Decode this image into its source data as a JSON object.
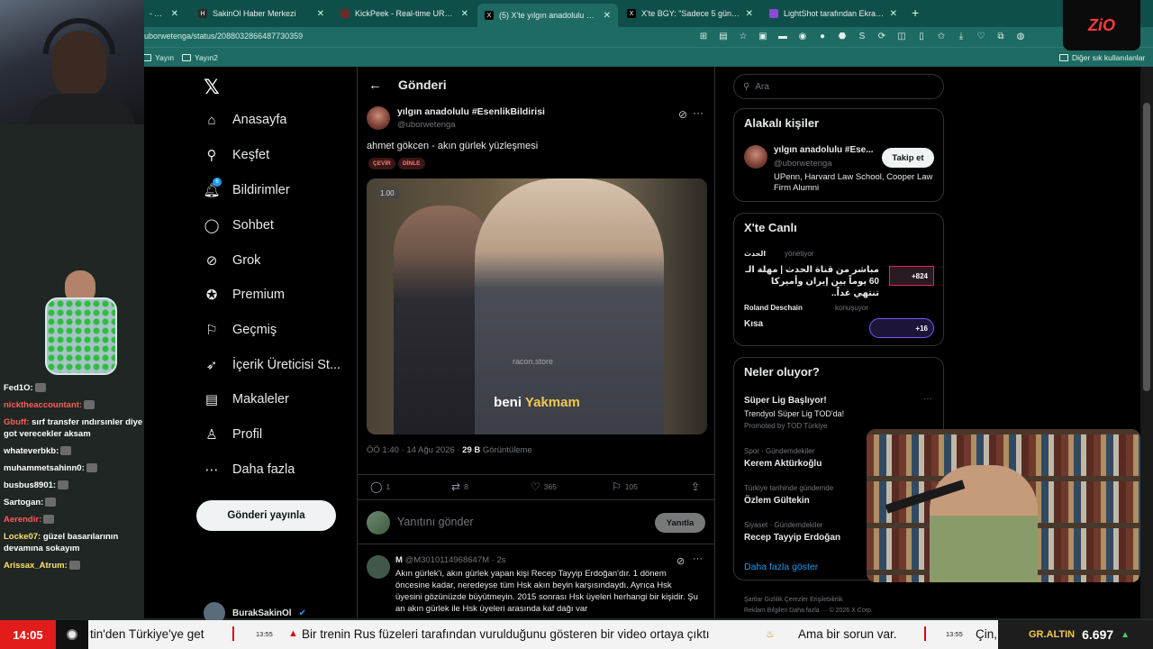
{
  "browser": {
    "tabs": [
      {
        "label": "- Arama -"
      },
      {
        "label": "SakinOl Haber Merkezi"
      },
      {
        "label": "KickPeek - Real-time URL Crawler"
      },
      {
        "label": "(5) X'te yılgın anadolulu #Esen"
      },
      {
        "label": "X'te BGY: \"Sadece 5 gün önce kün"
      },
      {
        "label": "LightShot tarafından Ekran Görün"
      }
    ],
    "url": "uborwetenga/status/2088032866487730359",
    "bookmarks": {
      "items": [
        "Yayın",
        "Yayın2"
      ],
      "other": "Diğer sık kullanılanlar"
    }
  },
  "nav": {
    "items": [
      {
        "label": "Anasayfa",
        "icon": "home-icon"
      },
      {
        "label": "Keşfet",
        "icon": "search-icon"
      },
      {
        "label": "Bildirimler",
        "icon": "bell-icon"
      },
      {
        "label": "Sohbet",
        "icon": "chat-icon"
      },
      {
        "label": "Grok",
        "icon": "grok-icon"
      },
      {
        "label": "Premium",
        "icon": "premium-icon"
      },
      {
        "label": "Geçmiş",
        "icon": "bookmark-icon"
      },
      {
        "label": "İçerik Üreticisi St...",
        "icon": "rocket-icon"
      },
      {
        "label": "Makaleler",
        "icon": "article-icon"
      },
      {
        "label": "Profil",
        "icon": "person-icon"
      },
      {
        "label": "Daha fazla",
        "icon": "more-circle-icon"
      }
    ],
    "notif_count": "6",
    "post_button": "Gönderi yayınla",
    "profile_name": "BurakSakinOl"
  },
  "post": {
    "header": "Gönderi",
    "author_name": "yılgın anadolulu #EsenlikBildirisi",
    "author_handle": "@uborwetenga",
    "text": "ahmet gökcen - akın gürlek yüzleşmesi",
    "pills": [
      "ÇEVİR",
      "DİNLE"
    ],
    "video": {
      "badge": "1.00",
      "watermark": "racon.store",
      "caption_white": "beni",
      "caption_yellow": "Yakmam"
    },
    "time": "ÖÖ 1:40 · 14 Ağu 2026 · ",
    "views": "29 B",
    "views_label": " Görüntüleme",
    "counts": {
      "replies": "1",
      "reposts": "8",
      "likes": "365",
      "bookmarks": "105"
    },
    "reply_placeholder": "Yanıtını gönder",
    "reply_button": "Yanıtla"
  },
  "comment": {
    "name": "M",
    "handle": "@M3010114968647M · 2s",
    "text": "Akın gürlek'i, akın gürlek yapan kişi Recep Tayyip Erdoğan'dır. 1 dönem öncesine kadar, neredeyse tüm Hsk akın beyin karşısındaydı. Ayrıca Hsk üyesini gözünüzde büyütmeyin. 2015 sonrası Hsk üyeleri herhangi bir kişidir. Şu an akın gürlek ile Hsk üyeleri arasında kaf dağı var"
  },
  "sidebar": {
    "search_placeholder": "Ara",
    "related_title": "Alakalı kişiler",
    "related_name": "yılgın anadolulu #Ese...",
    "related_handle": "@uborwetenga",
    "related_bio": "UPenn, Harvard Law School, Cooper Law Firm Alumni",
    "follow_label": "Takip et",
    "live_title": "X'te Canlı",
    "live1_host": "الحدث",
    "live1_status": "yönetiyor",
    "live1_text": "مباشر من قناة الحدث | مهلة الـ 60 يوماً بين إيران وأميركا تنتهي غداً..",
    "live1_count": "+824",
    "live2_host": "Roland Deschain",
    "live2_status": "konuşuyor",
    "live2_text": "Kısa",
    "live2_count": "+16",
    "trends_title": "Neler oluyor?",
    "trends": [
      {
        "meta": "",
        "name": "Süper Lig Başlıyor!"
      },
      {
        "meta": "Spor · Gündemdekiler",
        "name": "Kerem Aktürkoğlu"
      },
      {
        "meta": "Türkiye tarihinde gündemde",
        "name": "Özlem Gültekin"
      },
      {
        "meta": "Siyaset · Gündemdekiler",
        "name": "Recep Tayyip Erdoğan"
      }
    ],
    "promo_line": "Trendyol Süper Lig TOD'da!",
    "promo_by": "Promoted by TOD Türkiye",
    "show_more": "Daha fazla göster",
    "footer1": "Şartlar   Gizlilik   Çerezler   Erişilebilirlik",
    "footer2": "Reklam Bilgileri   Daha fazla ···   © 2026 X Corp."
  },
  "chat": [
    {
      "user": "Fed1O:",
      "msg": ""
    },
    {
      "user": "nicktheaccountant:",
      "msg": ""
    },
    {
      "user": "Gbuff:",
      "msg": "sırf transfer ındırsınler diye got verecekler aksam"
    },
    {
      "user": "whateverbkb:",
      "msg": ""
    },
    {
      "user": "muhammetsahinn0:",
      "msg": ""
    },
    {
      "user": "busbus8901:",
      "msg": ""
    },
    {
      "user": "Sartogan:",
      "msg": ""
    },
    {
      "user": "Aerendir:",
      "msg": ""
    },
    {
      "user": "Locke07:",
      "msg": "güzel basarılarının devamına sokayım"
    },
    {
      "user": "Arissax_Atrum:",
      "msg": ""
    }
  ],
  "stream": {
    "logo": "ZiO"
  },
  "ticker": {
    "clock": "14:05",
    "items": [
      {
        "time": "",
        "text": "tin'den Türkiye'ye get"
      },
      {
        "time": "13:55",
        "text": "Bir trenin Rus füzeleri tarafından vurulduğunu gösteren bir video ortaya çıktı"
      },
      {
        "time": "",
        "text": "Ama bir sorun var."
      },
      {
        "time": "13:55",
        "text": "Çin,"
      }
    ],
    "gold_label": "GR.ALTIN",
    "gold_value": "6.697",
    "gold_arrow": "▲"
  },
  "colors": {
    "accent": "#1d9bf0",
    "browser": "#1d6b63",
    "ticker_red": "#e21b1b",
    "gold": "#f6c84a"
  }
}
